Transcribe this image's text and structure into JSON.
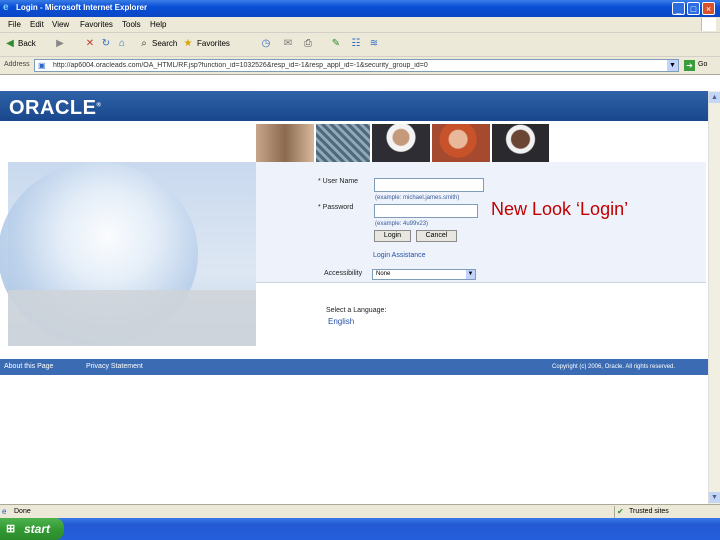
{
  "window": {
    "title": "Login - Microsoft Internet Explorer"
  },
  "menu": [
    "File",
    "Edit",
    "View",
    "Favorites",
    "Tools",
    "Help"
  ],
  "toolbar": {
    "back": "Back",
    "search": "Search",
    "favorites": "Favorites"
  },
  "address": {
    "label": "Address",
    "url": "http://ap6004.oracleads.com/OA_HTML/RF.jsp?function_id=1032526&resp_id=-1&resp_appl_id=-1&security_group_id=0",
    "go": "Go"
  },
  "oracle": {
    "logo": "ORACLE",
    "tm": "®"
  },
  "login": {
    "username_label": "* User Name",
    "username_value": "",
    "username_hint": "(example: michael.james.smith)",
    "password_label": "* Password",
    "password_value": "",
    "password_hint": "(example: 4u99v23)",
    "login_button": "Login",
    "cancel_button": "Cancel",
    "assistance_link": "Login Assistance",
    "accessibility_label": "Accessibility",
    "accessibility_value": "None"
  },
  "annotation": "New Look ‘Login’",
  "language": {
    "label": "Select a Language:",
    "english": "English"
  },
  "footer": {
    "about": "About this Page",
    "privacy": "Privacy Statement",
    "copyright": "Copyright (c) 2006, Oracle. All rights reserved."
  },
  "status": {
    "done": "Done",
    "zone": "Trusted sites"
  },
  "taskbar": {
    "start": "start"
  },
  "colors": {
    "oracle_blue": "#19478d",
    "annotation_red": "#c00000",
    "taskbar_blue": "#245edb",
    "start_green": "#339a33"
  }
}
